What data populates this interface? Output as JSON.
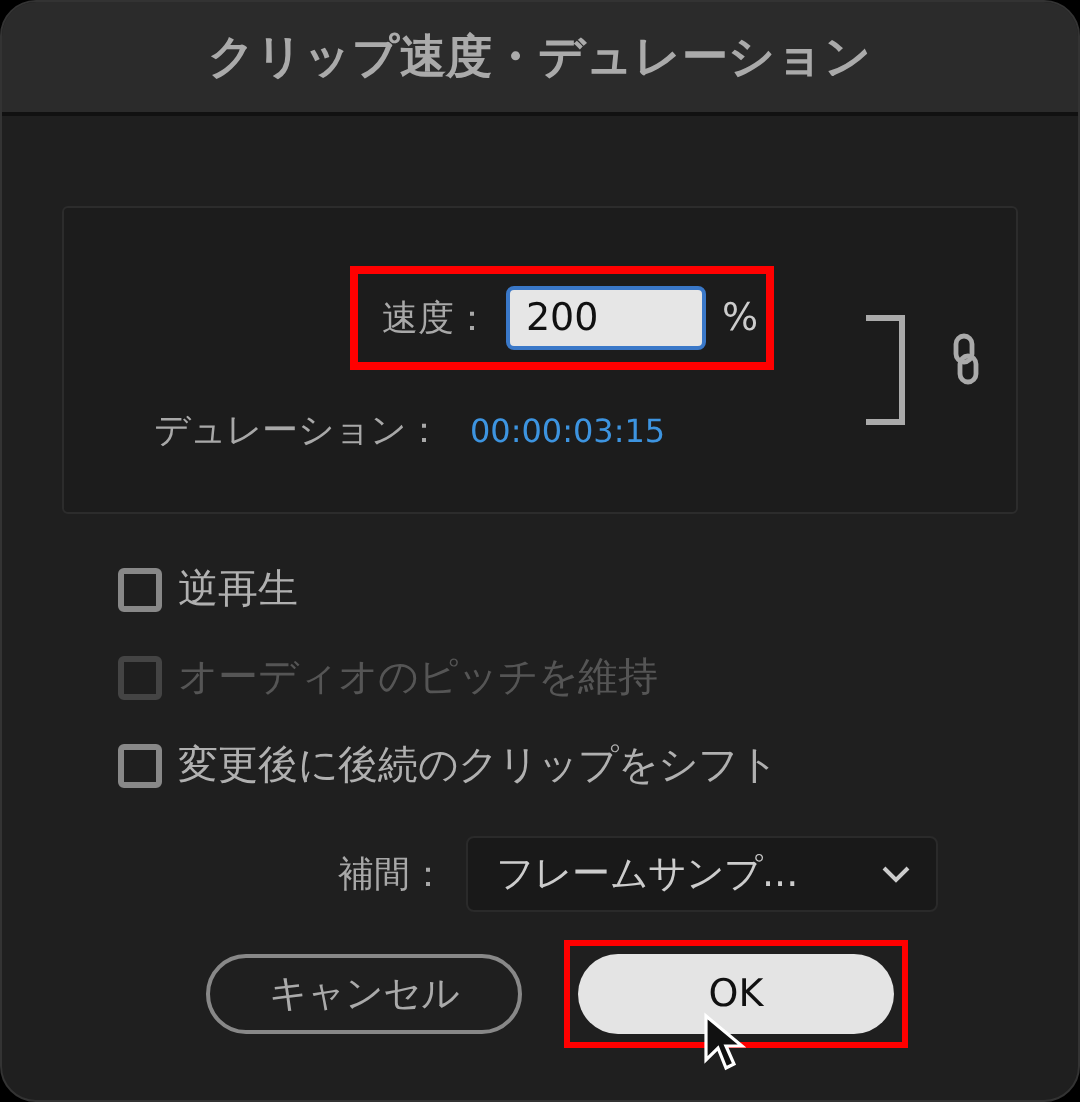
{
  "window": {
    "title": "クリップ速度・デュレーション"
  },
  "speed": {
    "label": "速度：",
    "value": "200",
    "unit": "%",
    "highlighted": true
  },
  "duration": {
    "label": "デュレーション：",
    "value": "00:00:03:15"
  },
  "checkboxes": [
    {
      "label": "逆再生",
      "checked": false,
      "disabled": false
    },
    {
      "label": "オーディオのピッチを維持",
      "checked": false,
      "disabled": true
    },
    {
      "label": "変更後に後続のクリップをシフト",
      "checked": false,
      "disabled": false
    }
  ],
  "interpolation": {
    "label": "補間：",
    "value": "フレームサンプ..."
  },
  "buttons": [
    {
      "label": "キャンセル",
      "kind": "secondary",
      "highlighted": false
    },
    {
      "label": "OK",
      "kind": "primary",
      "highlighted": true
    }
  ]
}
